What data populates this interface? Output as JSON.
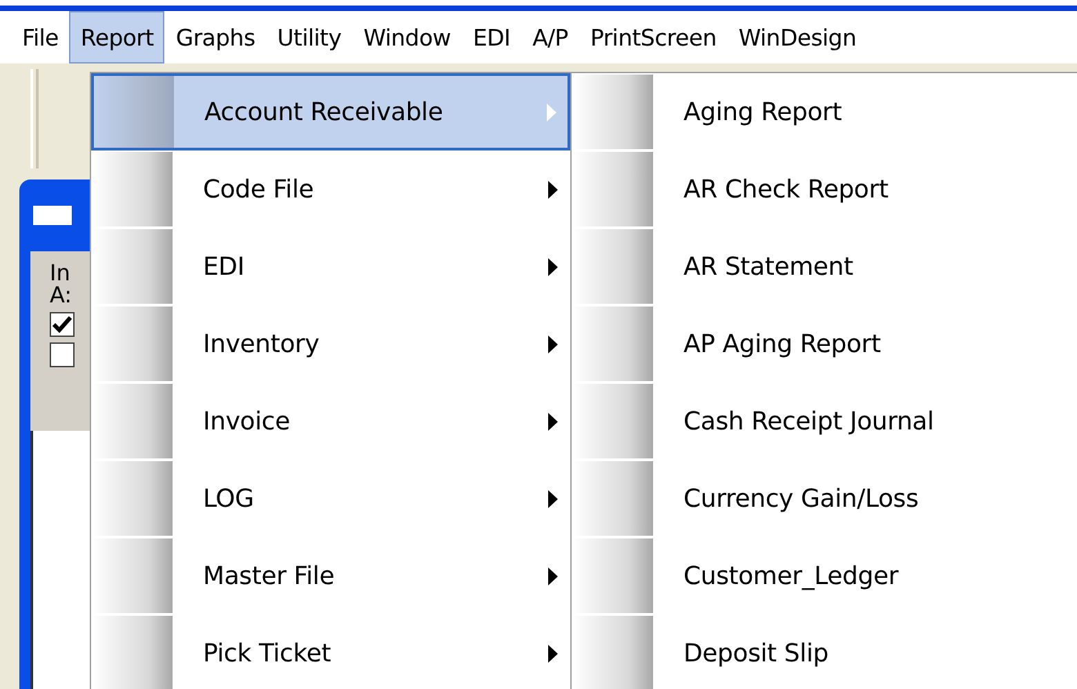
{
  "menubar": [
    {
      "label": "File",
      "selected": false
    },
    {
      "label": "Report",
      "selected": true
    },
    {
      "label": "Graphs",
      "selected": false
    },
    {
      "label": "Utility",
      "selected": false
    },
    {
      "label": "Window",
      "selected": false
    },
    {
      "label": "EDI",
      "selected": false
    },
    {
      "label": "A/P",
      "selected": false
    },
    {
      "label": "PrintScreen",
      "selected": false
    },
    {
      "label": "WinDesign",
      "selected": false
    }
  ],
  "background_window": {
    "labels": [
      "In",
      "A:"
    ],
    "checkboxes": [
      {
        "checked": true
      },
      {
        "checked": false
      }
    ]
  },
  "report_menu": [
    {
      "label": "Account Receivable",
      "selected": true
    },
    {
      "label": "Code File",
      "selected": false
    },
    {
      "label": "EDI",
      "selected": false
    },
    {
      "label": "Inventory",
      "selected": false
    },
    {
      "label": "Invoice",
      "selected": false
    },
    {
      "label": "LOG",
      "selected": false
    },
    {
      "label": "Master File",
      "selected": false
    },
    {
      "label": "Pick Ticket",
      "selected": false
    }
  ],
  "submenu": [
    {
      "label": "Aging Report"
    },
    {
      "label": "AR Check Report"
    },
    {
      "label": "AR Statement"
    },
    {
      "label": "AP Aging Report"
    },
    {
      "label": "Cash Receipt Journal"
    },
    {
      "label": "Currency Gain/Loss"
    },
    {
      "label": "Customer_Ledger"
    },
    {
      "label": "Deposit Slip"
    }
  ]
}
